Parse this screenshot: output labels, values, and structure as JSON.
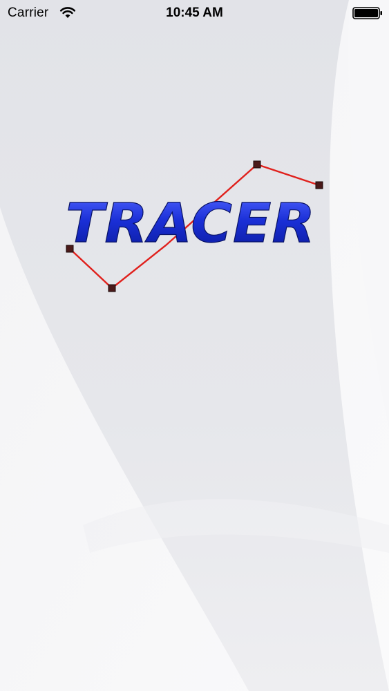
{
  "status_bar": {
    "carrier": "Carrier",
    "time": "10:45 AM",
    "wifi_icon": "wifi-icon",
    "battery_icon": "battery-full-icon"
  },
  "splash": {
    "logo_text": "TRACER",
    "logo_color": "#1a2fd6",
    "trace_line_color": "#e0201c",
    "trace_node_color": "#4a1a1a"
  }
}
